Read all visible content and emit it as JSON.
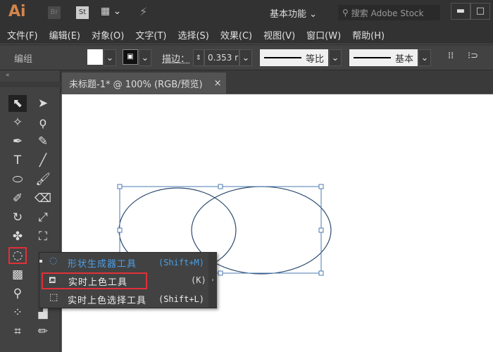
{
  "app": {
    "logo": "Ai",
    "bridge": "Br",
    "stock": "St",
    "workspace": "基本功能",
    "search_placeholder": "搜索 Adobe Stock"
  },
  "menu": [
    "文件(F)",
    "编辑(E)",
    "对象(O)",
    "文字(T)",
    "选择(S)",
    "效果(C)",
    "视图(V)",
    "窗口(W)",
    "帮助(H)"
  ],
  "control": {
    "selection": "编组",
    "stroke_label": "描边：",
    "stroke_value": "0.353 r",
    "profile": "等比",
    "brush": "基本"
  },
  "tab": {
    "title": "未标题-1* @ 100% (RGB/预览)",
    "close": "×"
  },
  "flyout": {
    "items": [
      {
        "label": "形状生成器工具",
        "shortcut": "(Shift+M)",
        "active": true
      },
      {
        "label": "实时上色工具",
        "shortcut": "(K)",
        "highlighted": true
      },
      {
        "label": "实时上色选择工具",
        "shortcut": "(Shift+L)"
      }
    ]
  },
  "colors": {
    "accent": "#4a9fe8",
    "highlight": "#e0303a",
    "logo": "#d4854a",
    "path": "#2c4a6e"
  }
}
